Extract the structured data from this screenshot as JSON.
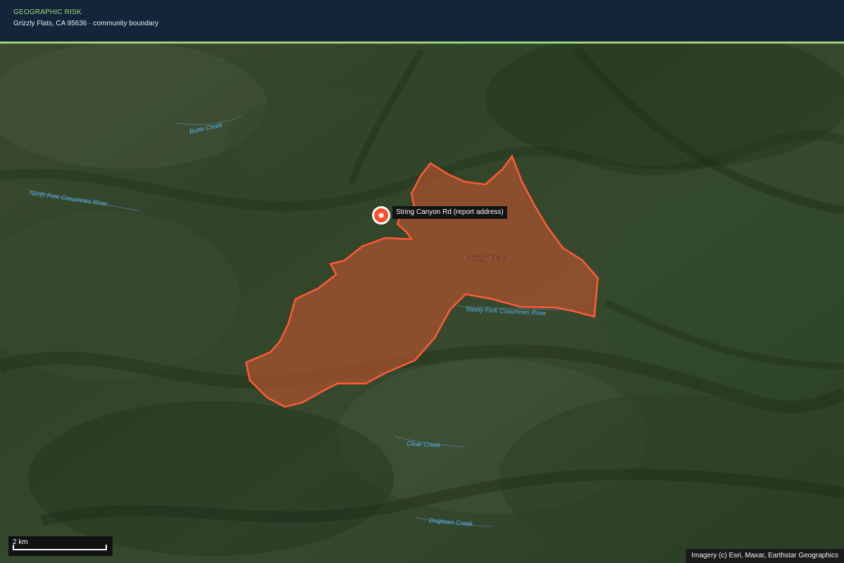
{
  "header": {
    "eyebrow": "GEOGRAPHIC RISK",
    "subtitle": "Grizzly Flats, CA 95636 · community boundary"
  },
  "map": {
    "community_label": "Grizzly Flats",
    "marker_label": "String Canyon Rd (report address)",
    "waterways": {
      "butte_creek": "Butte Creek",
      "north_fork": "North Fork Cosumnes River",
      "steely_fork": "Steely Fork Cosumnes River",
      "clear_creek": "Clear Creek",
      "dogtown_creek": "Dogtown Creek"
    },
    "boundary_color": "#ff5a36",
    "fill_color": "#b0532f",
    "marker_color": "#ff4d2e",
    "water_label_color": "#5ab4f0"
  },
  "scale": {
    "label": "2 km"
  },
  "attribution": "Imagery (c) Esri, Maxar, Earthstar Geographics"
}
